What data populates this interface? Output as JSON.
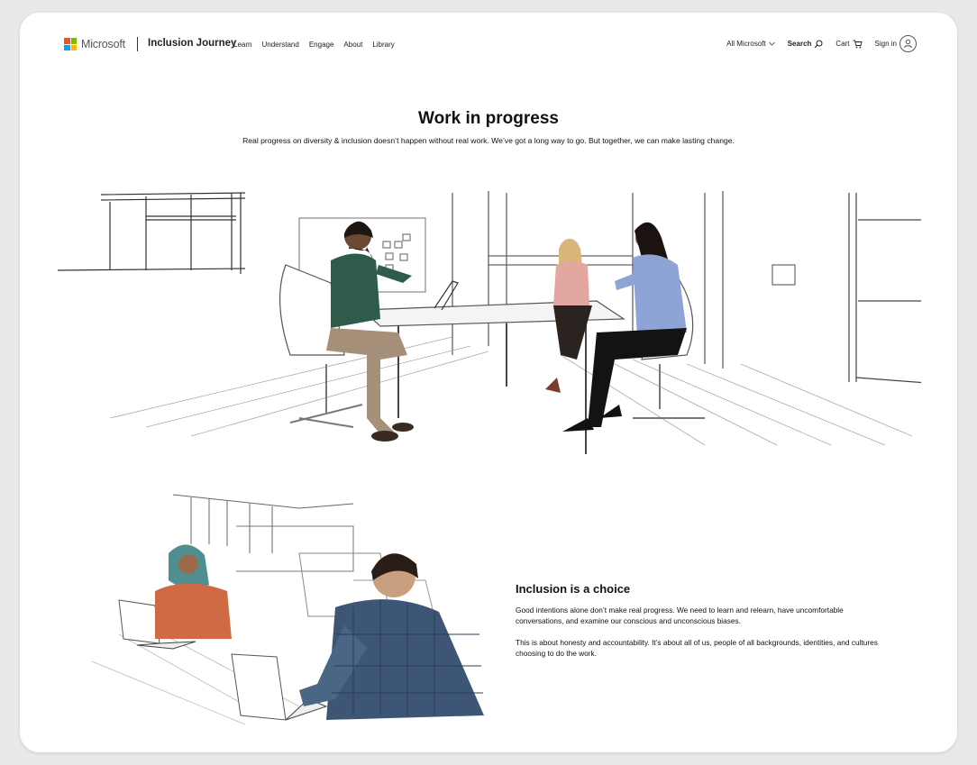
{
  "header": {
    "brand": "Microsoft",
    "site_title": "Inclusion Journey",
    "nav": [
      "Learn",
      "Understand",
      "Engage",
      "About",
      "Library"
    ],
    "all_microsoft": "All Microsoft",
    "search": "Search",
    "cart": "Cart",
    "sign_in": "Sign in"
  },
  "hero": {
    "title": "Work in progress",
    "subtitle": "Real progress on diversity & inclusion doesn’t happen without real work. We’ve got a long way to go. But together, we can make lasting change."
  },
  "section2": {
    "title": "Inclusion is a choice",
    "paragraph1": "Good intentions alone don’t make real progress. We need to learn and relearn, have uncomfortable conversations, and examine our conscious and unconscious biases.",
    "paragraph2": "This is about honesty and accountability. It’s about all of us, people of all backgrounds, identities, and cultures choosing to do the work."
  },
  "colors": {
    "ms_red": "#f25022",
    "ms_green": "#7fba00",
    "ms_blue": "#00a4ef",
    "ms_yellow": "#ffb900"
  },
  "icons": [
    "microsoft-logo",
    "chevron-down-icon",
    "search-icon",
    "cart-icon",
    "user-icon"
  ]
}
